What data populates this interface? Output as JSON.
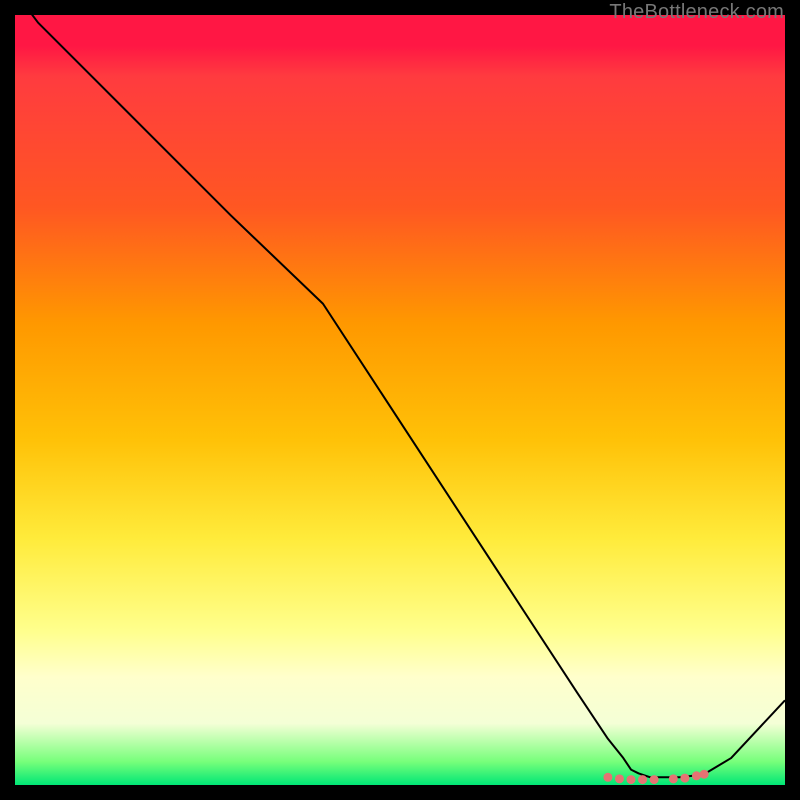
{
  "attribution": "TheBottleneck.com",
  "chart_data": {
    "type": "line",
    "title": "",
    "xlabel": "",
    "ylabel": "",
    "xlim": [
      0,
      100
    ],
    "ylim": [
      0,
      100
    ],
    "grid": false,
    "legend": false,
    "series": [
      {
        "name": "bottleneck-curve",
        "color": "#000000",
        "width": 2,
        "x": [
          0,
          3,
          28,
          40,
          73,
          77,
          79,
          80,
          81,
          82.5,
          84,
          85,
          86.5,
          88,
          89,
          90,
          93,
          100
        ],
        "values": [
          103,
          99,
          74,
          62.5,
          12,
          6,
          3.5,
          2,
          1.5,
          1,
          1,
          1,
          1,
          1.2,
          1.4,
          1.7,
          3.5,
          11
        ]
      }
    ],
    "markers": {
      "name": "highlight-cluster",
      "color": "#e57373",
      "radius": 4.5,
      "points": [
        {
          "x": 77.0,
          "y": 1.0
        },
        {
          "x": 78.5,
          "y": 0.8
        },
        {
          "x": 80.0,
          "y": 0.7
        },
        {
          "x": 81.5,
          "y": 0.7
        },
        {
          "x": 83.0,
          "y": 0.7
        },
        {
          "x": 85.5,
          "y": 0.8
        },
        {
          "x": 87.0,
          "y": 0.9
        },
        {
          "x": 88.5,
          "y": 1.2
        },
        {
          "x": 89.5,
          "y": 1.4
        }
      ]
    }
  }
}
